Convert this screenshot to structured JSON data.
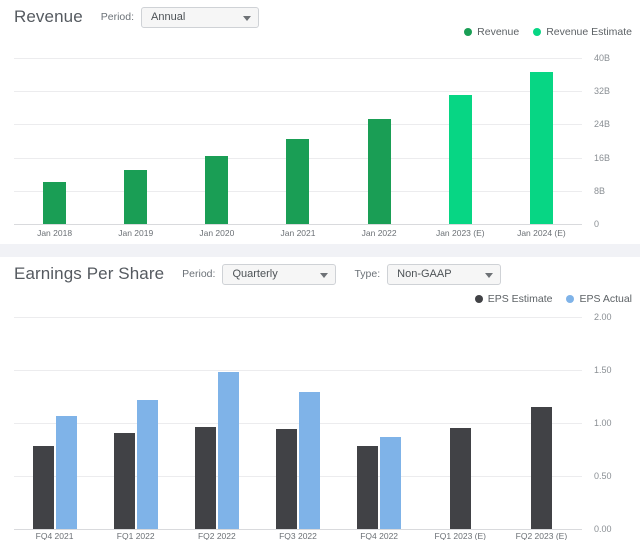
{
  "revenue_panel": {
    "title": "Revenue",
    "period_label": "Period:",
    "period_value": "Annual",
    "legend": [
      {
        "label": "Revenue",
        "color": "#1a9e55"
      },
      {
        "label": "Revenue Estimate",
        "color": "#07d684"
      }
    ]
  },
  "eps_panel": {
    "title": "Earnings Per Share",
    "period_label": "Period:",
    "period_value": "Quarterly",
    "type_label": "Type:",
    "type_value": "Non-GAAP",
    "legend": [
      {
        "label": "EPS Estimate",
        "color": "#414246"
      },
      {
        "label": "EPS Actual",
        "color": "#7fb3e8"
      }
    ]
  },
  "icons": {
    "caret": "chevron-down-icon"
  },
  "chart_data": [
    {
      "type": "bar",
      "title": "Revenue",
      "xlabel": "",
      "ylabel": "",
      "ylim": [
        0,
        40
      ],
      "yticks": [
        "0",
        "8B",
        "16B",
        "24B",
        "32B",
        "40B"
      ],
      "ytick_values": [
        0,
        8,
        16,
        24,
        32,
        40
      ],
      "grid": true,
      "legend_position": "top-right",
      "categories": [
        "Jan 2018",
        "Jan 2019",
        "Jan 2020",
        "Jan 2021",
        "Jan 2022",
        "Jan 2023 (E)",
        "Jan 2024 (E)"
      ],
      "series": [
        {
          "name": "Revenue",
          "color": "#1a9e55",
          "values": [
            10.1,
            12.9,
            16.5,
            20.6,
            25.3,
            null,
            null
          ]
        },
        {
          "name": "Revenue Estimate",
          "color": "#07d684",
          "values": [
            null,
            null,
            null,
            null,
            null,
            31.0,
            36.7
          ]
        }
      ]
    },
    {
      "type": "bar",
      "title": "Earnings Per Share",
      "xlabel": "",
      "ylabel": "",
      "ylim": [
        0,
        2.0
      ],
      "yticks": [
        "0.00",
        "0.50",
        "1.00",
        "1.50",
        "2.00"
      ],
      "ytick_values": [
        0,
        0.5,
        1.0,
        1.5,
        2.0
      ],
      "grid": true,
      "legend_position": "top-right",
      "categories": [
        "FQ4 2021",
        "FQ1 2022",
        "FQ2 2022",
        "FQ3 2022",
        "FQ4 2022",
        "FQ1 2023 (E)",
        "FQ2 2023 (E)"
      ],
      "series": [
        {
          "name": "EPS Estimate",
          "color": "#414246",
          "values": [
            0.78,
            0.91,
            0.96,
            0.94,
            0.78,
            0.95,
            1.15
          ]
        },
        {
          "name": "EPS Actual",
          "color": "#7fb3e8",
          "values": [
            1.07,
            1.22,
            1.48,
            1.29,
            0.87,
            null,
            null
          ]
        }
      ]
    }
  ]
}
